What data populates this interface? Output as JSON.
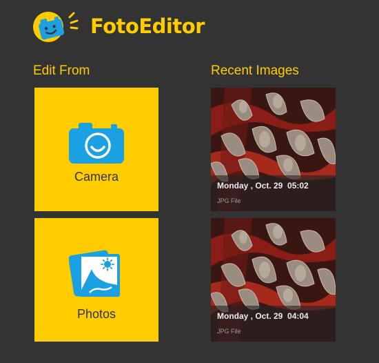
{
  "app": {
    "title": "FotoEditor",
    "accent": "#FFCC00",
    "logo_icon": "smiling-camera-icon"
  },
  "edit_from": {
    "heading": "Edit From",
    "camera": {
      "label": "Camera",
      "icon": "camera-icon"
    },
    "photos": {
      "label": "Photos",
      "icon": "photos-icon"
    }
  },
  "recent": {
    "heading": "Recent Images",
    "items": [
      {
        "date": "Monday , Oct. 29  05:02",
        "type": "JPG File"
      },
      {
        "date": "Monday , Oct. 29  04:04",
        "type": "JPG File"
      }
    ]
  },
  "colors": {
    "background": "#333333",
    "tile": "#FFCC00",
    "icon_blue": "#1BA1E2",
    "tile_text": "#333333"
  }
}
